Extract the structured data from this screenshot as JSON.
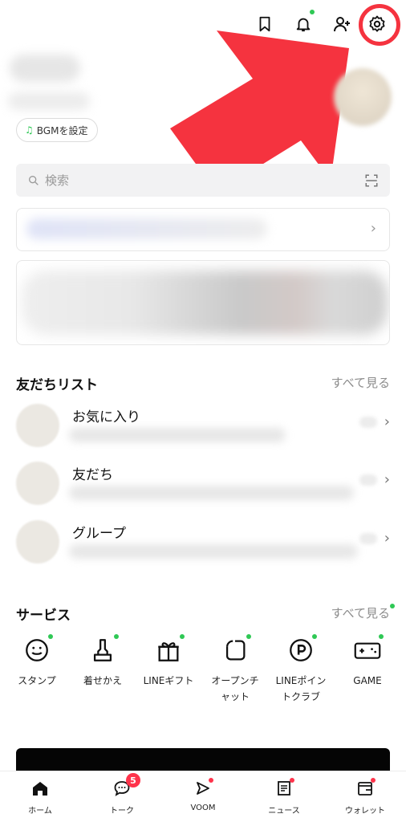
{
  "header": {
    "icons": [
      "bookmark-icon",
      "bell-icon",
      "add-friend-icon",
      "settings-icon"
    ],
    "bgm_label": "BGMを設定"
  },
  "search": {
    "placeholder": "検索",
    "qr_icon": "qr-scan-icon"
  },
  "friends_section": {
    "title": "友だちリスト",
    "see_all": "すべて見る",
    "rows": [
      {
        "label": "お気に入り"
      },
      {
        "label": "友だち"
      },
      {
        "label": "グループ"
      }
    ]
  },
  "services_section": {
    "title": "サービス",
    "see_all": "すべて見る",
    "items": [
      {
        "label": "スタンプ",
        "icon": "smile-icon"
      },
      {
        "label": "着せかえ",
        "icon": "brush-icon"
      },
      {
        "label": "LINEギフト",
        "icon": "gift-icon"
      },
      {
        "label": "オープンチャット",
        "icon": "open-chat-icon"
      },
      {
        "label": "LINEポイントクラブ",
        "icon": "points-icon"
      },
      {
        "label": "GAME",
        "icon": "game-icon"
      }
    ]
  },
  "bottom_nav": {
    "items": [
      {
        "label": "ホーム",
        "icon": "home-icon"
      },
      {
        "label": "トーク",
        "icon": "chat-icon",
        "badge": "5"
      },
      {
        "label": "VOOM",
        "icon": "voom-icon"
      },
      {
        "label": "ニュース",
        "icon": "news-icon"
      },
      {
        "label": "ウォレット",
        "icon": "wallet-icon"
      }
    ]
  },
  "colors": {
    "accent_green": "#2fc855",
    "badge_red": "#ff334b",
    "annotation_red": "#f5333f"
  }
}
